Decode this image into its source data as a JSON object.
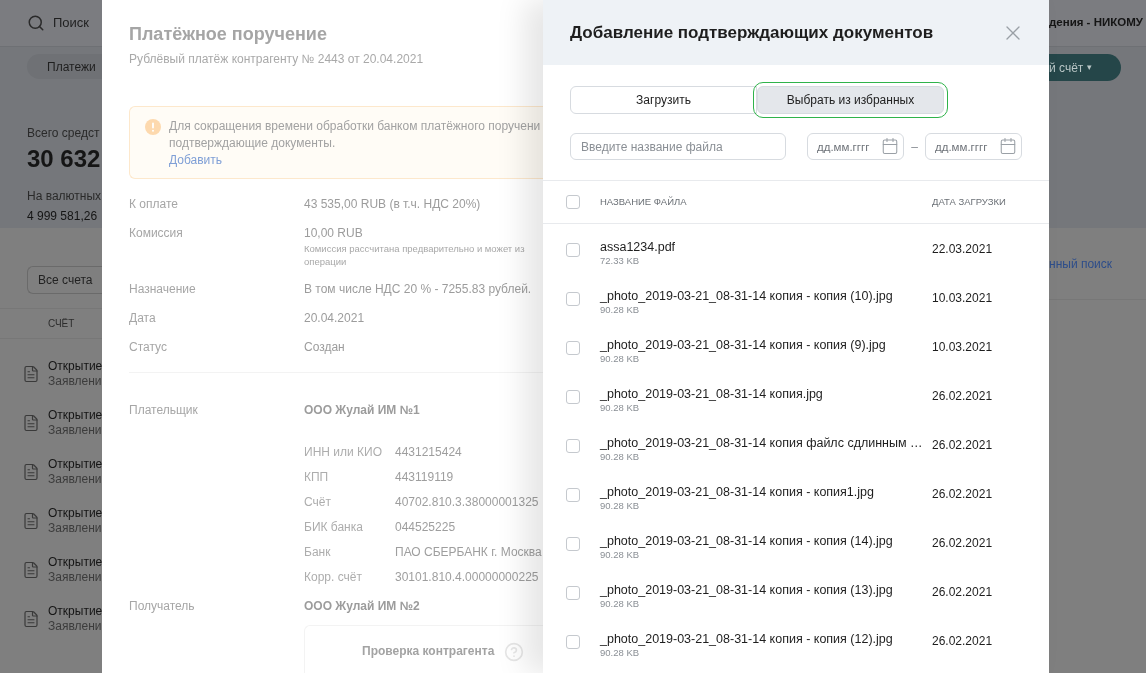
{
  "background": {
    "search_label": "Поиск",
    "nav_tab": "Платежи",
    "total_label": "Всего средст",
    "total_amount": "30 632",
    "currency_label": "На валютных",
    "currency_amount": "4 999 581,26",
    "account_filter": "Все счета",
    "column_header": "СЧЁТ",
    "rows": [
      {
        "title": "Открытие",
        "subtitle": "Заявлени"
      },
      {
        "title": "Открытие",
        "subtitle": "Заявлени"
      },
      {
        "title": "Открытие",
        "subtitle": "Заявлени"
      },
      {
        "title": "Открытие",
        "subtitle": "Заявлени"
      },
      {
        "title": "Открытие",
        "subtitle": "Заявлени"
      },
      {
        "title": "Открытие",
        "subtitle": "Заявлени"
      }
    ],
    "org_name": "дения - НИКОМУ",
    "account_button": "й счёт",
    "account_caret": "▾",
    "search_link": "нный поиск"
  },
  "payment_panel": {
    "title": "Платёжное поручение",
    "subtitle": "Рублёвый платёж контрагенту № 2443 от 20.04.2021",
    "alert": {
      "lines": [
        "Для сокращения времени обработки банком платёжного поручени",
        "подтверждающие документы."
      ],
      "link": "Добавить"
    },
    "fields": [
      {
        "label": "К оплате",
        "value": "43 535,00 RUB (в т.ч. НДС 20%)"
      },
      {
        "label": "Комиссия",
        "value": "10,00 RUB",
        "note": [
          "Комиссия рассчитана предварительно и может из",
          "операции"
        ]
      },
      {
        "label": "Назначение",
        "value": "В том числе НДС 20 % - 7255.83 рублей."
      },
      {
        "label": "Дата",
        "value": "20.04.2021"
      },
      {
        "label": "Статус",
        "value": "Создан"
      }
    ],
    "payer": {
      "label": "Плательщик",
      "name": "ООО Жулай ИМ №1",
      "details": [
        {
          "label": "ИНН или КИО",
          "value": "4431215424"
        },
        {
          "label": "КПП",
          "value": "443119119"
        },
        {
          "label": "Счёт",
          "value": "40702.810.3.38000001325"
        },
        {
          "label": "БИК банка",
          "value": "044525225"
        },
        {
          "label": "Банк",
          "value": "ПАО СБЕРБАНК г. Москва"
        },
        {
          "label": "Корр. счёт",
          "value": "30101.810.4.00000000225"
        }
      ]
    },
    "recipient": {
      "label": "Получатель",
      "name": "ООО Жулай ИМ №2",
      "check_button": "Проверка контрагента"
    }
  },
  "drawer": {
    "title": "Добавление подтверждающих документов",
    "tabs": [
      {
        "label": "Загрузить",
        "selected": false
      },
      {
        "label": "Выбрать из избранных",
        "selected": true
      }
    ],
    "search": {
      "placeholder": "Введите название файла"
    },
    "date_from": {
      "placeholder": "дд.мм.гггг"
    },
    "date_separator": "–",
    "date_to": {
      "placeholder": "дд.мм.гггг"
    },
    "select_all": {
      "checked": false
    },
    "columns": [
      "НАЗВАНИЕ ФАЙЛА",
      "ДАТА ЗАГРУЗКИ"
    ],
    "files": [
      {
        "name": "assa1234.pdf",
        "size": "72.33 KB",
        "date": "22.03.2021",
        "checked": false
      },
      {
        "name": "_photo_2019-03-21_08-31-14 копия - копия (10).jpg",
        "size": "90.28 KB",
        "date": "10.03.2021",
        "checked": false
      },
      {
        "name": "_photo_2019-03-21_08-31-14 копия - копия (9).jpg",
        "size": "90.28 KB",
        "date": "10.03.2021",
        "checked": false
      },
      {
        "name": "_photo_2019-03-21_08-31-14 копия.jpg",
        "size": "90.28 KB",
        "date": "26.02.2021",
        "checked": false
      },
      {
        "name": "_photo_2019-03-21_08-31-14 копия файлс сдлинным …",
        "size": "90.28 KB",
        "date": "26.02.2021",
        "checked": false
      },
      {
        "name": "_photo_2019-03-21_08-31-14 копия - копия1.jpg",
        "size": "90.28 KB",
        "date": "26.02.2021",
        "checked": false
      },
      {
        "name": "_photo_2019-03-21_08-31-14 копия - копия (14).jpg",
        "size": "90.28 KB",
        "date": "26.02.2021",
        "checked": false
      },
      {
        "name": "_photo_2019-03-21_08-31-14 копия - копия (13).jpg",
        "size": "90.28 KB",
        "date": "26.02.2021",
        "checked": false
      },
      {
        "name": "_photo_2019-03-21_08-31-14 копия - копия (12).jpg",
        "size": "90.28 KB",
        "date": "26.02.2021",
        "checked": false
      }
    ]
  }
}
